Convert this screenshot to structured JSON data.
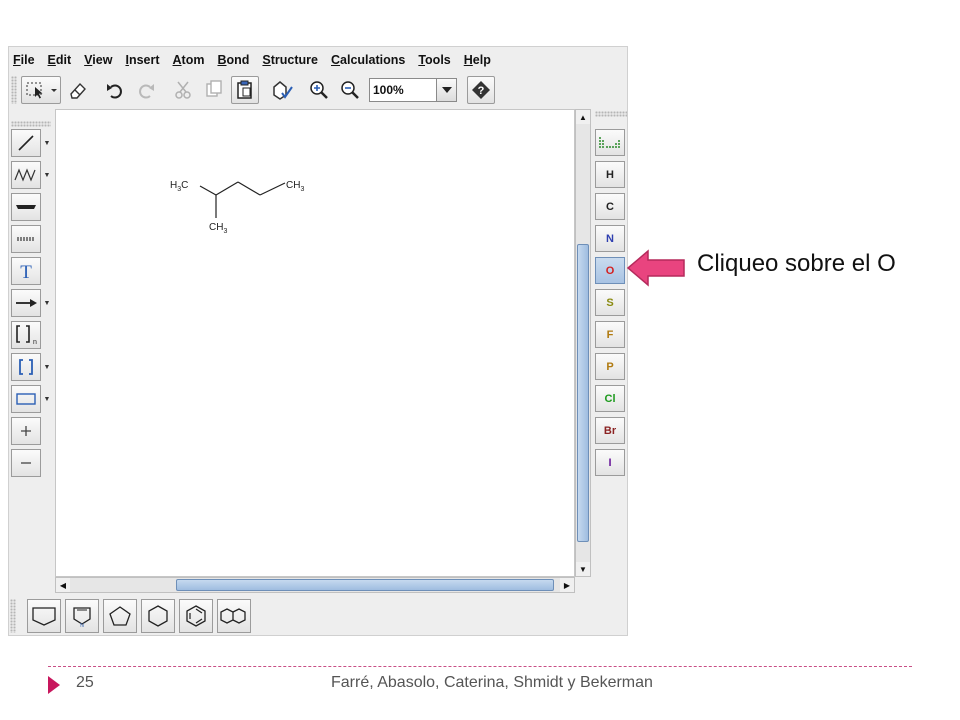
{
  "menu": [
    "File",
    "Edit",
    "View",
    "Insert",
    "Atom",
    "Bond",
    "Structure",
    "Calculations",
    "Tools",
    "Help"
  ],
  "toolbar": {
    "zoom_value": "100%",
    "icons": [
      "select-icon",
      "eraser-icon",
      "undo-icon",
      "redo-icon",
      "cut-icon",
      "copy-icon",
      "paste-icon",
      "clean-icon",
      "zoom-in-icon",
      "zoom-out-icon",
      "help-icon"
    ]
  },
  "left_tools": [
    "single-bond",
    "chain",
    "bold-bond",
    "hash-bond",
    "text",
    "arrow",
    "sgroup-bracket",
    "bracket",
    "rectangle",
    "charge-plus",
    "charge-minus"
  ],
  "molecule": {
    "atom_labels": [
      "H3C",
      "CH3",
      "CH3"
    ]
  },
  "elements": [
    {
      "symbol": "H",
      "color": "#222222"
    },
    {
      "symbol": "C",
      "color": "#222222"
    },
    {
      "symbol": "N",
      "color": "#2f3fb0"
    },
    {
      "symbol": "O",
      "color": "#d42020",
      "selected": true
    },
    {
      "symbol": "S",
      "color": "#8a8a10"
    },
    {
      "symbol": "F",
      "color": "#b07a10"
    },
    {
      "symbol": "P",
      "color": "#b07a10"
    },
    {
      "symbol": "Cl",
      "color": "#1c9a1c"
    },
    {
      "symbol": "Br",
      "color": "#8b2222"
    },
    {
      "symbol": "I",
      "color": "#6a1a9a"
    }
  ],
  "rings": [
    "cyclopropane-template",
    "pyrrole-template",
    "cyclopentane-template",
    "cyclohexane-template",
    "benzene-template",
    "naphthalene-template"
  ],
  "callout": {
    "text": "Cliqueo sobre el O",
    "arrow_color": "#e9447f"
  },
  "footer": {
    "slide_number": "25",
    "credit": "Farré, Abasolo, Caterina, Shmidt y Bekerman",
    "accent": "#c8175d"
  }
}
